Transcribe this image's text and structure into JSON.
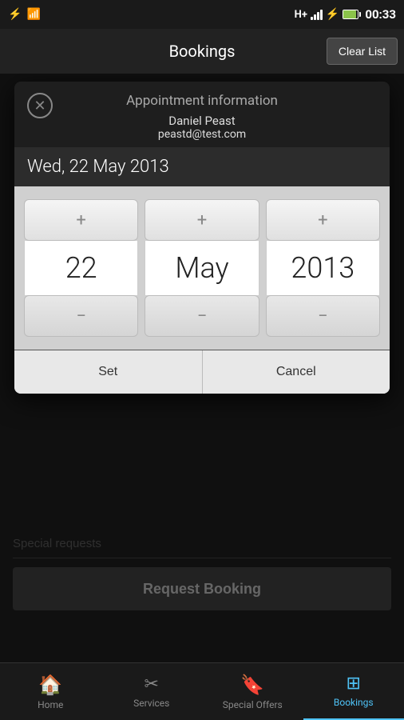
{
  "statusBar": {
    "time": "00:33",
    "icons": {
      "usb": "⚡",
      "wifi": "wifi",
      "hPlus": "H+",
      "signal": "signal",
      "battery": "battery"
    }
  },
  "header": {
    "title": "Bookings",
    "clearListLabel": "Clear List"
  },
  "modal": {
    "closeIcon": "✕",
    "title": "Appointment information",
    "userName": "Daniel Peast",
    "userEmail": "peastd@test.com",
    "dateDisplay": "Wed, 22 May 2013",
    "picker": {
      "day": {
        "value": "22",
        "plusLabel": "+",
        "minusLabel": "−"
      },
      "month": {
        "value": "May",
        "plusLabel": "+",
        "minusLabel": "−"
      },
      "year": {
        "value": "2013",
        "plusLabel": "+",
        "minusLabel": "−"
      }
    },
    "setLabel": "Set",
    "cancelLabel": "Cancel"
  },
  "form": {
    "specialRequestsPlaceholder": "Special requests"
  },
  "requestBookingLabel": "Request Booking",
  "bottomNav": {
    "items": [
      {
        "id": "home",
        "label": "Home",
        "icon": "🏠",
        "active": false
      },
      {
        "id": "services",
        "label": "Services",
        "icon": "✂",
        "active": false
      },
      {
        "id": "special-offers",
        "label": "Special Offers",
        "icon": "🔖",
        "active": false
      },
      {
        "id": "bookings",
        "label": "Bookings",
        "icon": "⊞",
        "active": true
      }
    ]
  }
}
